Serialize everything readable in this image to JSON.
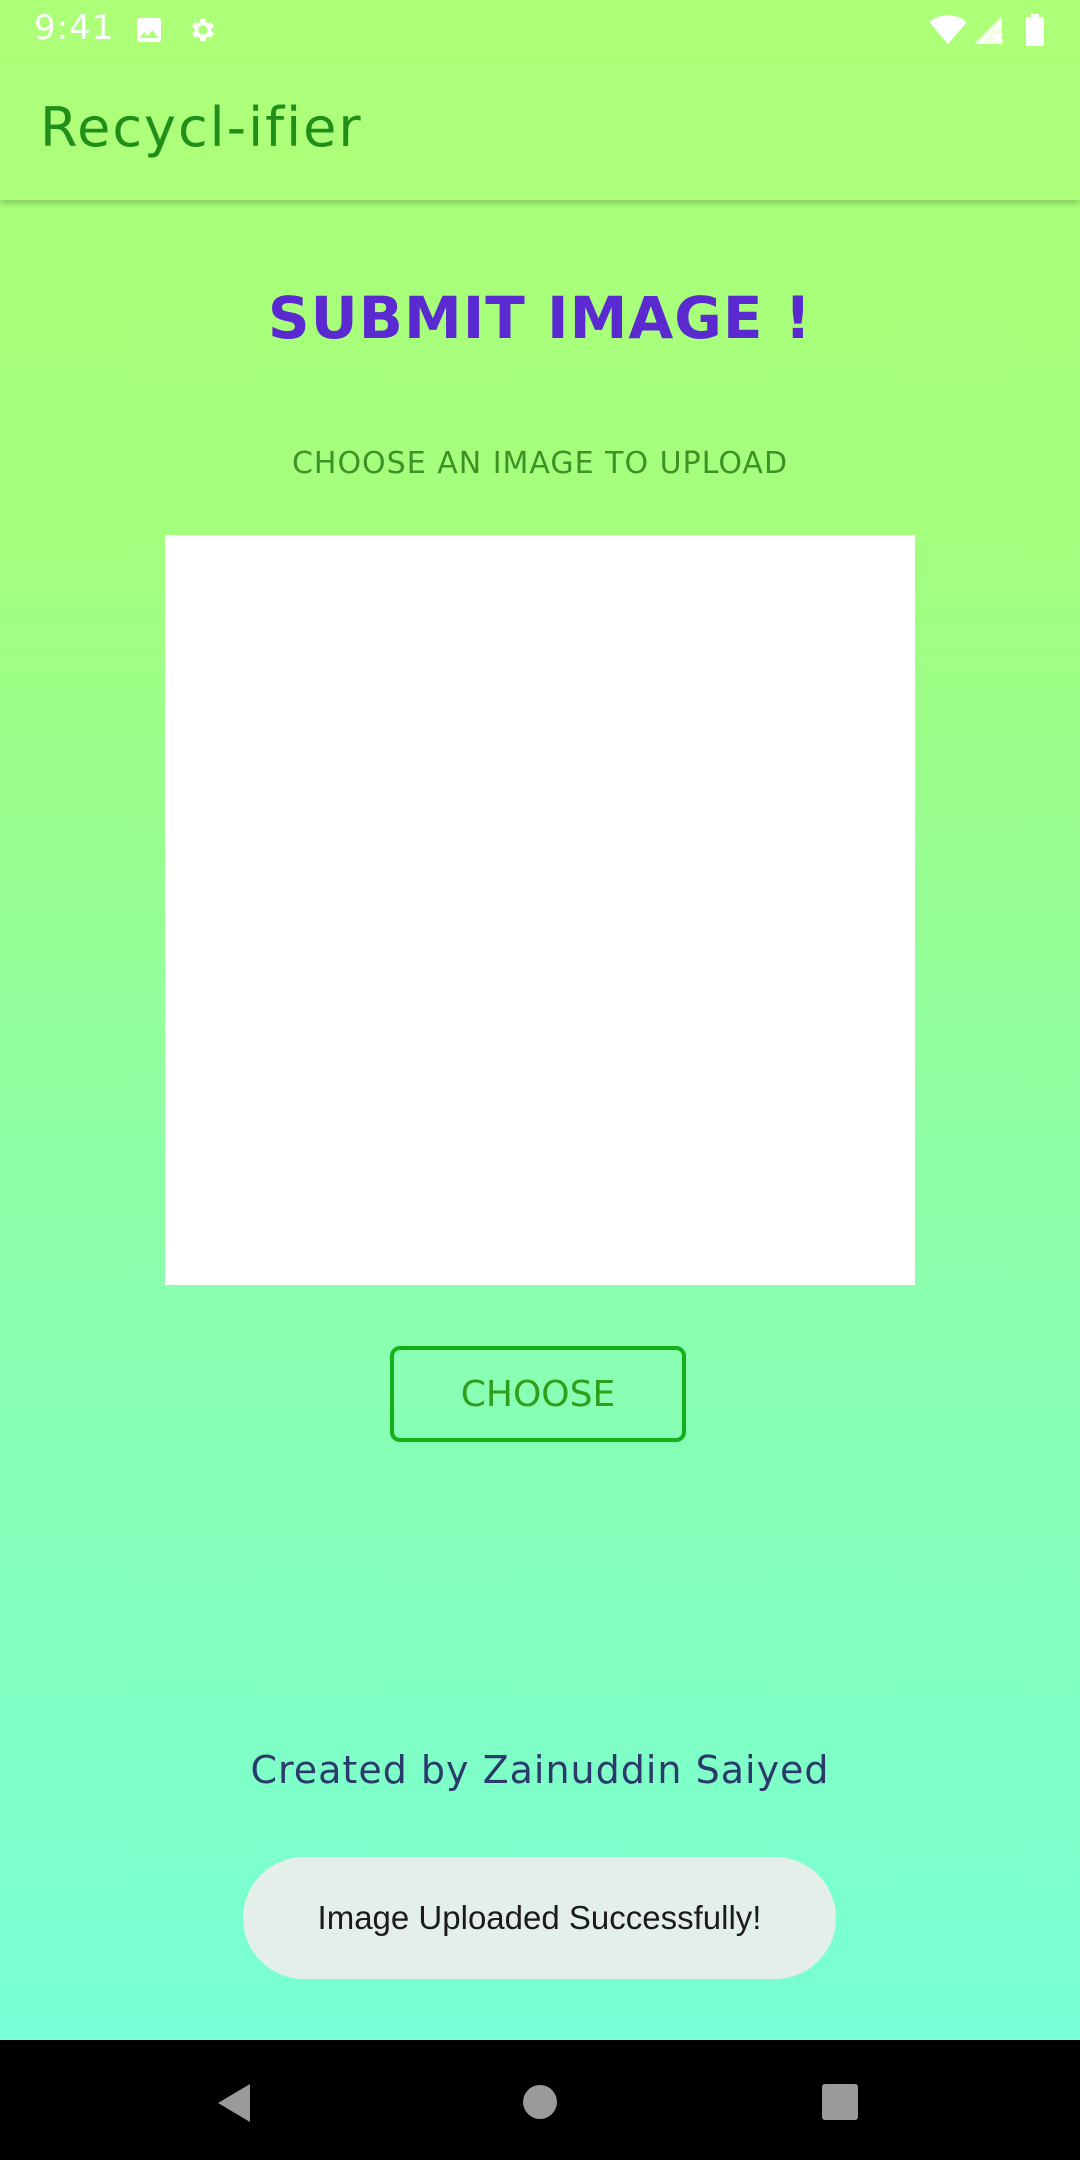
{
  "status_bar": {
    "time": "9:41",
    "left_icons": [
      "image-icon",
      "settings-icon"
    ],
    "right_icons": [
      "wifi-icon",
      "signal-icon",
      "battery-icon"
    ]
  },
  "app_bar": {
    "title": "Recycl-ifier"
  },
  "main": {
    "heading": "SUBMIT IMAGE !",
    "subheading": "CHOOSE AN IMAGE TO UPLOAD",
    "choose_label": "CHOOSE",
    "credit": "Created  by  Zainuddin Saiyed"
  },
  "toast": {
    "message": "Image Uploaded Successfully!"
  },
  "nav_bar": {
    "buttons": [
      "back-icon",
      "home-icon",
      "recents-icon"
    ]
  },
  "colors": {
    "app_bar_bg": "#adff79",
    "title_green": "#1f8f1a",
    "heading_purple": "#5a2ad0",
    "button_border": "#13b01a",
    "credit_navy": "#2a3a6a"
  }
}
